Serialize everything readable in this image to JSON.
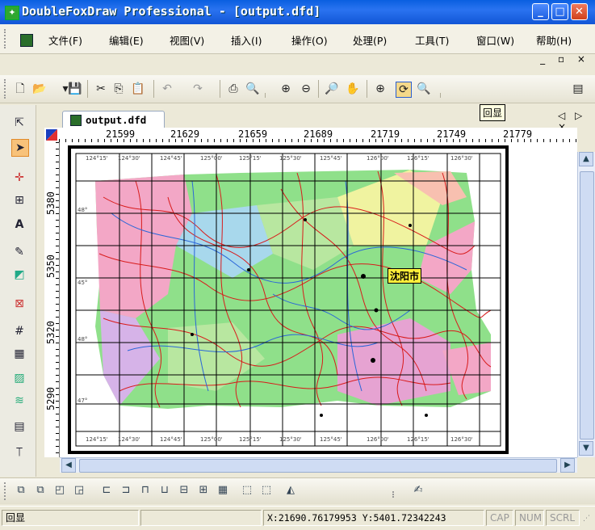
{
  "window": {
    "title": "DoubleFoxDraw Professional - [output.dfd]",
    "app_icon": "doublefox-app-icon",
    "minimize": "_",
    "maximize": "□",
    "close": "✕"
  },
  "menu": {
    "items": [
      "文件(F)",
      "编辑(E)",
      "视图(V)",
      "插入(I)",
      "操作(O)",
      "处理(P)",
      "工具(T)",
      "窗口(W)",
      "帮助(H)"
    ],
    "mdi_controls": "_ ▫ ×"
  },
  "toolbar": {
    "icons": [
      "new-file-icon",
      "open-folder-icon",
      "save-icon",
      "cut-icon",
      "copy-icon",
      "paste-icon",
      "undo-icon",
      "redo-icon",
      "print-icon",
      "print-preview-icon",
      "zoom-in-icon",
      "zoom-out-icon",
      "zoom-window-icon",
      "pan-icon",
      "zoom-extent-icon",
      "redisplay-icon",
      "zoom-all-icon"
    ],
    "tooltip": "回显"
  },
  "document_tab": {
    "label": "output.dfd",
    "nav": "◁ ▷ ×"
  },
  "ruler": {
    "top_labels": [
      "21599",
      "21629",
      "21659",
      "21689",
      "21719",
      "21749",
      "21779"
    ],
    "left_labels": [
      "5380",
      "5350",
      "5320",
      "5290"
    ]
  },
  "map": {
    "city_label": "沈阳市",
    "lon_top": [
      "124°15'",
      "124°30'",
      "124°45'",
      "125°00'",
      "125°15'",
      "125°30'",
      "125°45'",
      "126°00'",
      "126°15'",
      "126°30'"
    ],
    "lon_bottom": [
      "124°15'",
      "124°30'",
      "124°45'",
      "125°00'",
      "125°15'",
      "125°30'",
      "125°45'",
      "126°00'",
      "126°15'",
      "126°30'"
    ],
    "lat_left": [
      "48°",
      "45°",
      "48°",
      "47°"
    ]
  },
  "statusbar": {
    "message": "回显",
    "coords": "X:21690.76179953 Y:5401.72342243",
    "cap": "CAP",
    "num": "NUM",
    "scrl": "SCRL"
  },
  "colors": {
    "titlebar": "#0a5fe0",
    "map_green": "#8fe08a",
    "map_pink": "#f3a7c6",
    "rivers": "#d81b1b",
    "grid": "#000000"
  }
}
